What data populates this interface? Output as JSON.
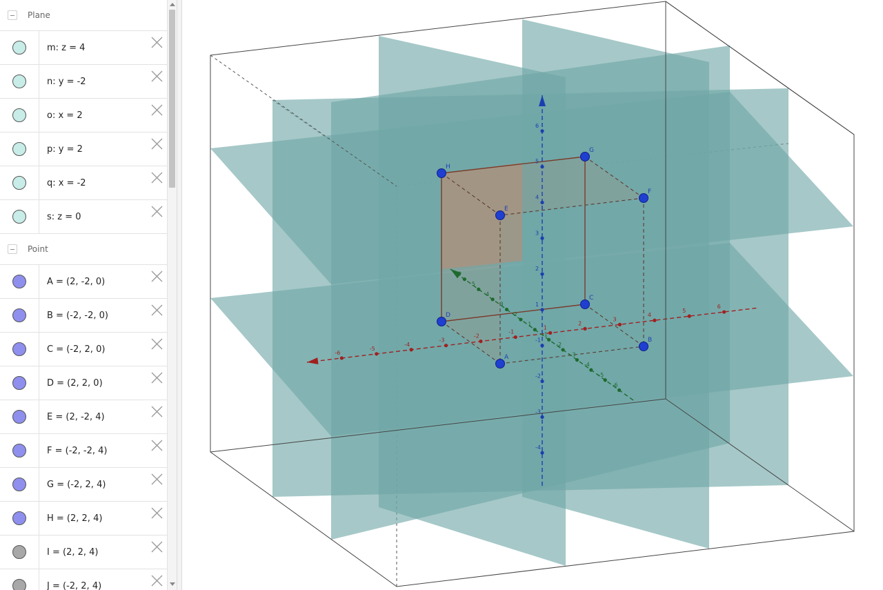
{
  "algebra": {
    "groups": [
      {
        "label": "Plane",
        "items": [
          {
            "text": "m: z = 4",
            "color": "#c8ece7"
          },
          {
            "text": "n: y = -2",
            "color": "#c8ece7"
          },
          {
            "text": "o: x = 2",
            "color": "#c8ece7"
          },
          {
            "text": "p: y = 2",
            "color": "#c8ece7"
          },
          {
            "text": "q: x = -2",
            "color": "#c8ece7"
          },
          {
            "text": "s: z = 0",
            "color": "#c8ece7"
          }
        ]
      },
      {
        "label": "Point",
        "items": [
          {
            "text": "A = (2, -2, 0)",
            "color": "#8f8fee"
          },
          {
            "text": "B = (-2, -2, 0)",
            "color": "#8f8fee"
          },
          {
            "text": "C = (-2, 2, 0)",
            "color": "#8f8fee"
          },
          {
            "text": "D = (2, 2, 0)",
            "color": "#8f8fee"
          },
          {
            "text": "E = (2, -2, 4)",
            "color": "#8f8fee"
          },
          {
            "text": "F = (-2, -2, 4)",
            "color": "#8f8fee"
          },
          {
            "text": "G = (-2, 2, 4)",
            "color": "#8f8fee"
          },
          {
            "text": "H = (2, 2, 4)",
            "color": "#8f8fee"
          },
          {
            "text": "I = (2, 2, 4)",
            "color": "#a8a8a8"
          },
          {
            "text": "J = (-2, 2, 4)",
            "color": "#a8a8a8"
          }
        ]
      }
    ]
  },
  "graphics": {
    "point_labels": [
      "A",
      "B",
      "C",
      "D",
      "E",
      "F",
      "G",
      "H"
    ],
    "x_axis_ticks": [
      "-6",
      "-5",
      "-4",
      "-3",
      "-2",
      "-1",
      "1",
      "2",
      "3",
      "4",
      "5",
      "6"
    ],
    "y_axis_ticks": [
      "6",
      "5",
      "4",
      "3",
      "2",
      "1",
      "-1",
      "-2",
      "-3",
      "-4",
      "-5",
      "-6"
    ],
    "z_axis_ticks": [
      "6",
      "5",
      "4",
      "3",
      "2",
      "1",
      "-1",
      "-2",
      "-3",
      "-4"
    ],
    "colors": {
      "plane": "#6fa6a6",
      "x_axis": "#a02020",
      "y_axis": "#1e6a2e",
      "z_axis": "#1a3fb0",
      "point": "#1f3fd0",
      "cube_face": "#c08a70"
    }
  }
}
